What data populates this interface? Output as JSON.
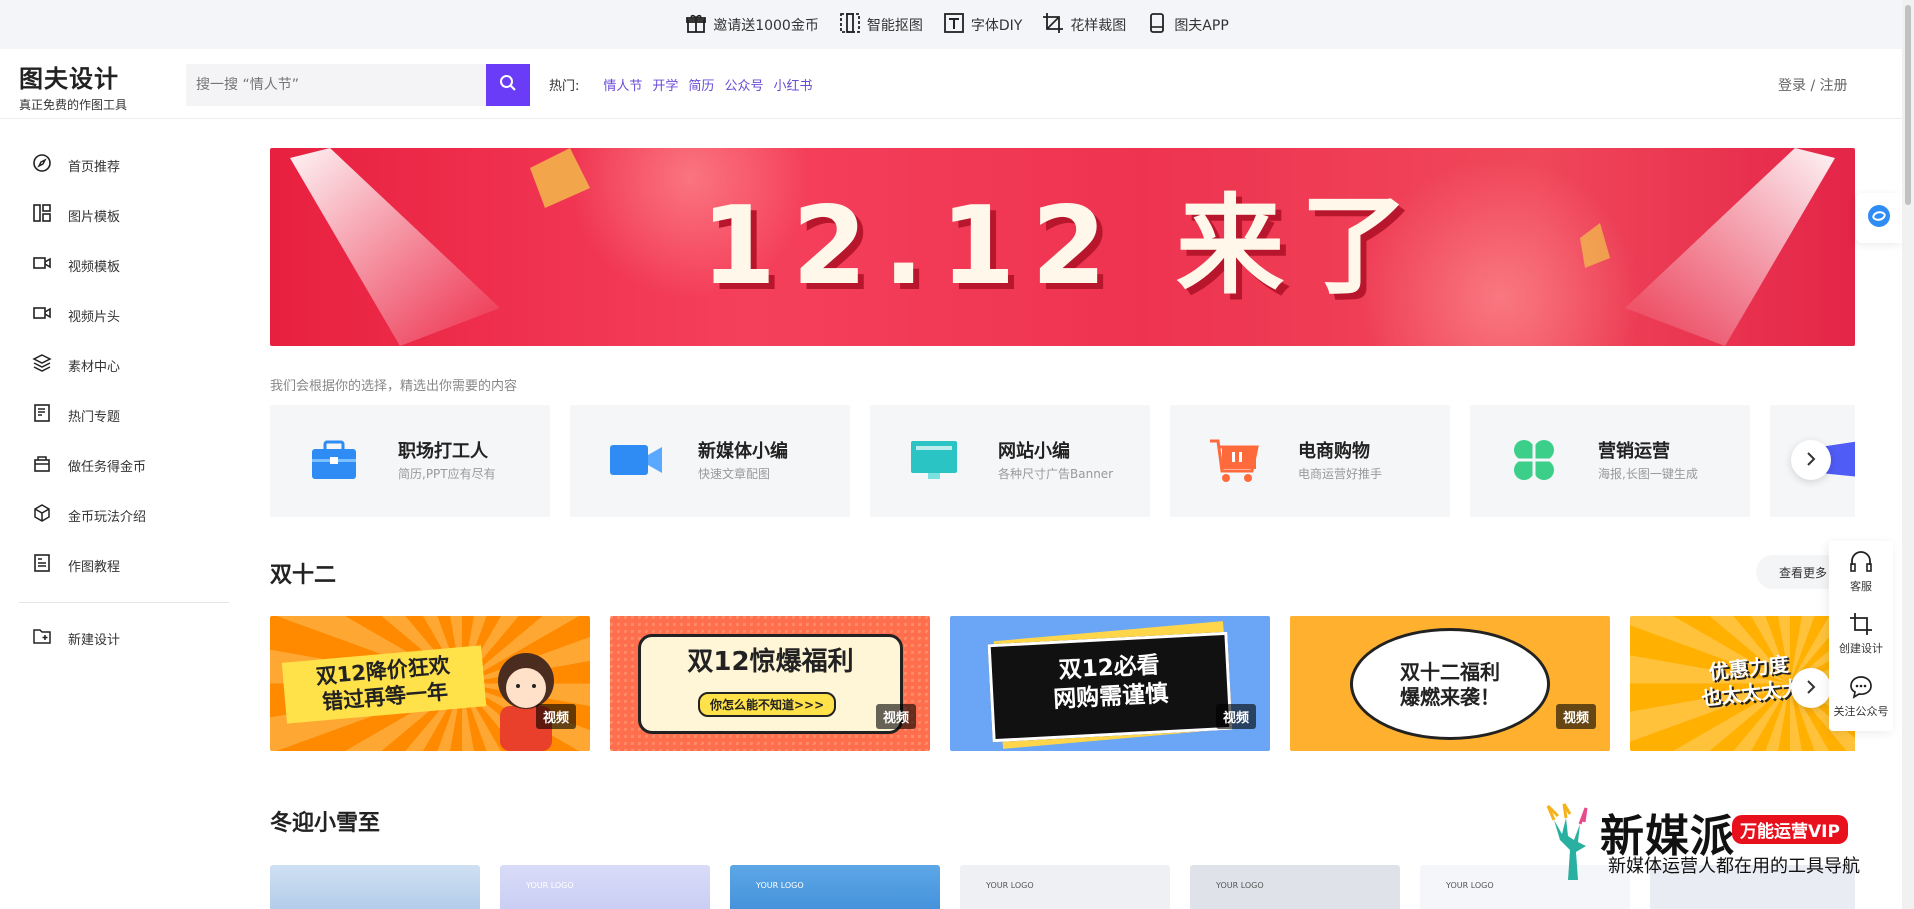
{
  "topbar": {
    "items": [
      {
        "label": "邀请送1000金币",
        "icon": "gift-icon"
      },
      {
        "label": "智能抠图",
        "icon": "cutout-icon"
      },
      {
        "label": "字体DIY",
        "icon": "text-icon"
      },
      {
        "label": "花样裁图",
        "icon": "crop-icon"
      },
      {
        "label": "图夫APP",
        "icon": "phone-icon"
      }
    ]
  },
  "header": {
    "logo_title": "图夫设计",
    "logo_subtitle": "真正免费的作图工具",
    "search_placeholder": "搜一搜 “情人节”",
    "hot_label": "热门:",
    "hot_items": [
      "情人节",
      "开学",
      "简历",
      "公众号",
      "小红书"
    ],
    "login": "登录 /",
    "register": "注册"
  },
  "sidebar": {
    "items": [
      {
        "label": "首页推荐",
        "icon": "compass-icon"
      },
      {
        "label": "图片模板",
        "icon": "layout-icon"
      },
      {
        "label": "视频模板",
        "icon": "video-icon"
      },
      {
        "label": "视频片头",
        "icon": "video-intro-icon"
      },
      {
        "label": "素材中心",
        "icon": "layers-icon"
      },
      {
        "label": "热门专题",
        "icon": "topic-icon"
      },
      {
        "label": "做任务得金币",
        "icon": "bag-icon"
      },
      {
        "label": "金币玩法介绍",
        "icon": "box-icon"
      },
      {
        "label": "作图教程",
        "icon": "doc-icon"
      }
    ],
    "new_design": {
      "label": "新建设计",
      "icon": "folder-plus-icon"
    }
  },
  "banner": {
    "headline": "12.12 来了"
  },
  "tagline": "我们会根据你的选择，精选出你需要的内容",
  "categories": [
    {
      "title": "职场打工人",
      "subtitle": "简历,PPT应有尽有",
      "icon": "briefcase-icon",
      "color": "#2f8cf5"
    },
    {
      "title": "新媒体小编",
      "subtitle": "快速文章配图",
      "icon": "camera-icon",
      "color": "#2f8cf5"
    },
    {
      "title": "网站小编",
      "subtitle": "各种尺寸广告Banner",
      "icon": "monitor-icon",
      "color": "#2bc4c4"
    },
    {
      "title": "电商购物",
      "subtitle": "电商运营好推手",
      "icon": "cart-icon",
      "color": "#ff6a3d"
    },
    {
      "title": "营销运营",
      "subtitle": "海报,长图一键生成",
      "icon": "clover-icon",
      "color": "#3ccf8a"
    }
  ],
  "section1": {
    "title": "双十二",
    "more": "查看更多",
    "video_badge": "视频",
    "thumbs": [
      {
        "line1": "双12降价狂欢",
        "line2": "错过再等一年"
      },
      {
        "line1": "双12惊爆福利",
        "line2": "你怎么能不知道>>>"
      },
      {
        "line1": "双12必看",
        "line2": "网购需谨慎"
      },
      {
        "line1": "双十二福利",
        "line2": "爆燃来袭！"
      },
      {
        "line1": "优惠力度",
        "line2": "也太太太大"
      }
    ]
  },
  "section2": {
    "title": "冬迎小雪至",
    "thumb_logo": "YOUR LOGO"
  },
  "right_float": {
    "items": [
      {
        "label": "客服",
        "icon": "headset-icon"
      },
      {
        "label": "创建设计",
        "icon": "crop-create-icon"
      },
      {
        "label": "关注公众号",
        "icon": "chat-bubble-icon"
      }
    ]
  },
  "watermark": {
    "brand": "新媒派",
    "badge": "万能运营VIP",
    "slogan": "新媒体运营人都在用的工具导航"
  },
  "colors": {
    "accent": "#6b3cf7",
    "hot_link": "#6b4bd8",
    "banner_red": "#ee3350"
  }
}
